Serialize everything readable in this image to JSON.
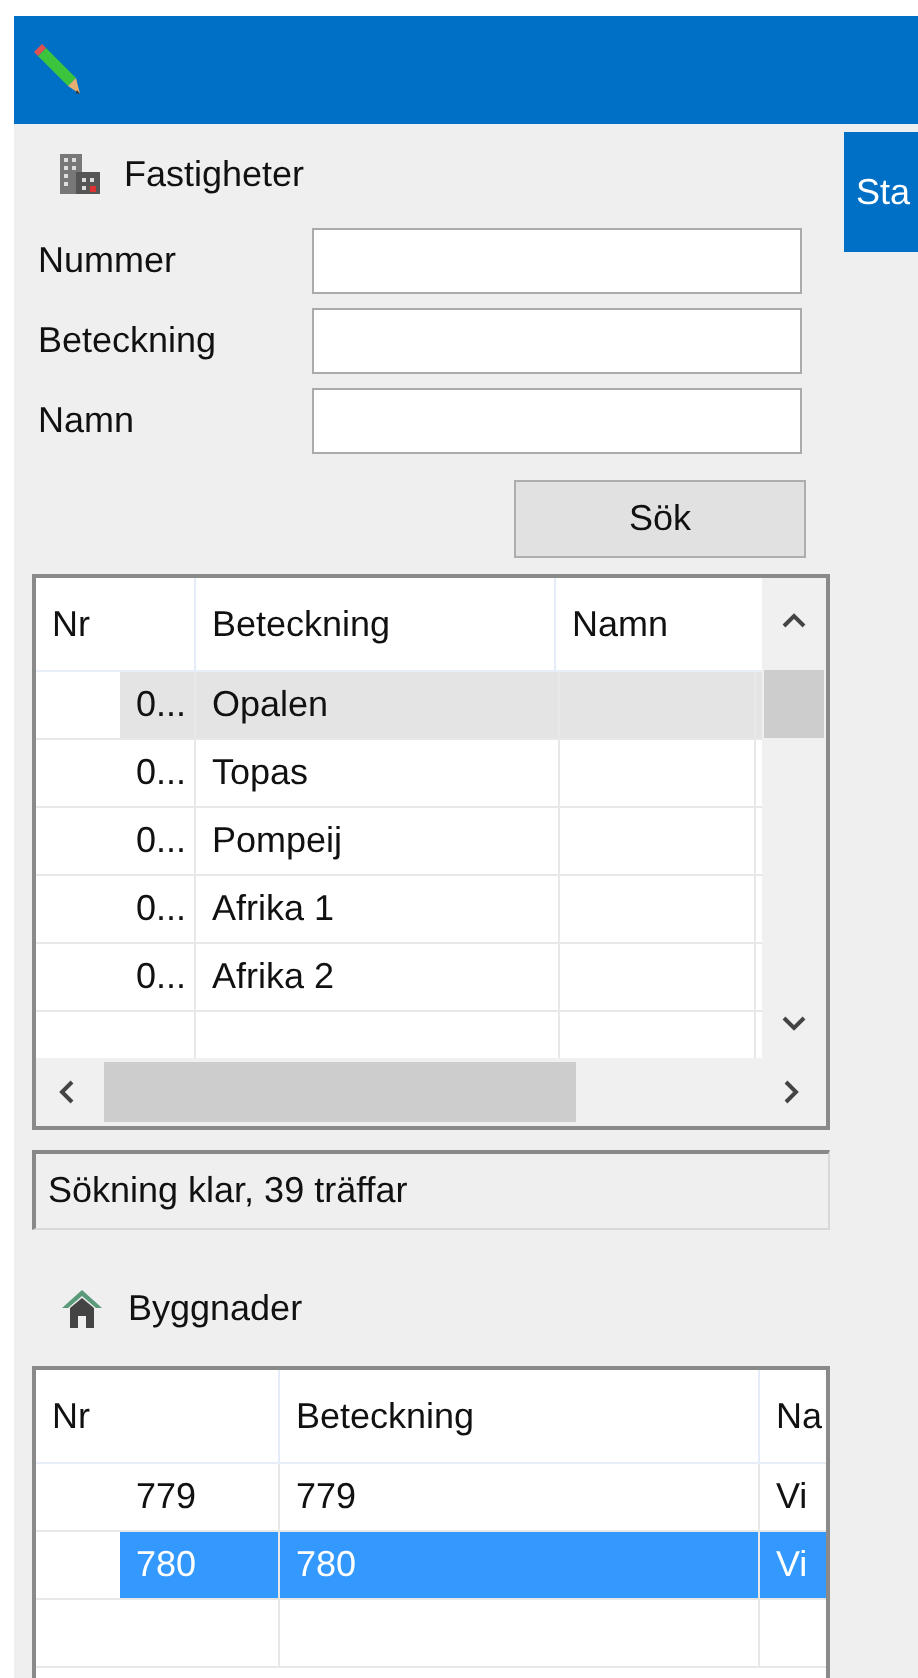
{
  "tab": {
    "label": "Sta"
  },
  "properties": {
    "title": "Fastigheter",
    "fields": [
      {
        "label": "Nummer"
      },
      {
        "label": "Beteckning"
      },
      {
        "label": "Namn"
      }
    ],
    "search_button": "Sök",
    "table": {
      "focused": false,
      "columns": [
        "Nr",
        "Beteckning",
        "Namn"
      ],
      "rows": [
        {
          "nr": "0...",
          "beteckning": "Opalen",
          "selected": true
        },
        {
          "nr": "0...",
          "beteckning": "Topas",
          "selected": false
        },
        {
          "nr": "0...",
          "beteckning": "Pompeij",
          "selected": false
        },
        {
          "nr": "0...",
          "beteckning": "Afrika 1",
          "selected": false
        },
        {
          "nr": "0...",
          "beteckning": "Afrika 2",
          "selected": false
        }
      ]
    },
    "status": "Sökning klar, 39 träffar"
  },
  "buildings": {
    "title": "Byggnader",
    "table": {
      "focused": true,
      "columns": [
        "Nr",
        "Beteckning",
        "Na"
      ],
      "rows": [
        {
          "nr": "779",
          "beteckning": "779",
          "namn": "Vi",
          "selected": false
        },
        {
          "nr": "780",
          "beteckning": "780",
          "namn": "Vi",
          "selected": true
        }
      ]
    }
  }
}
